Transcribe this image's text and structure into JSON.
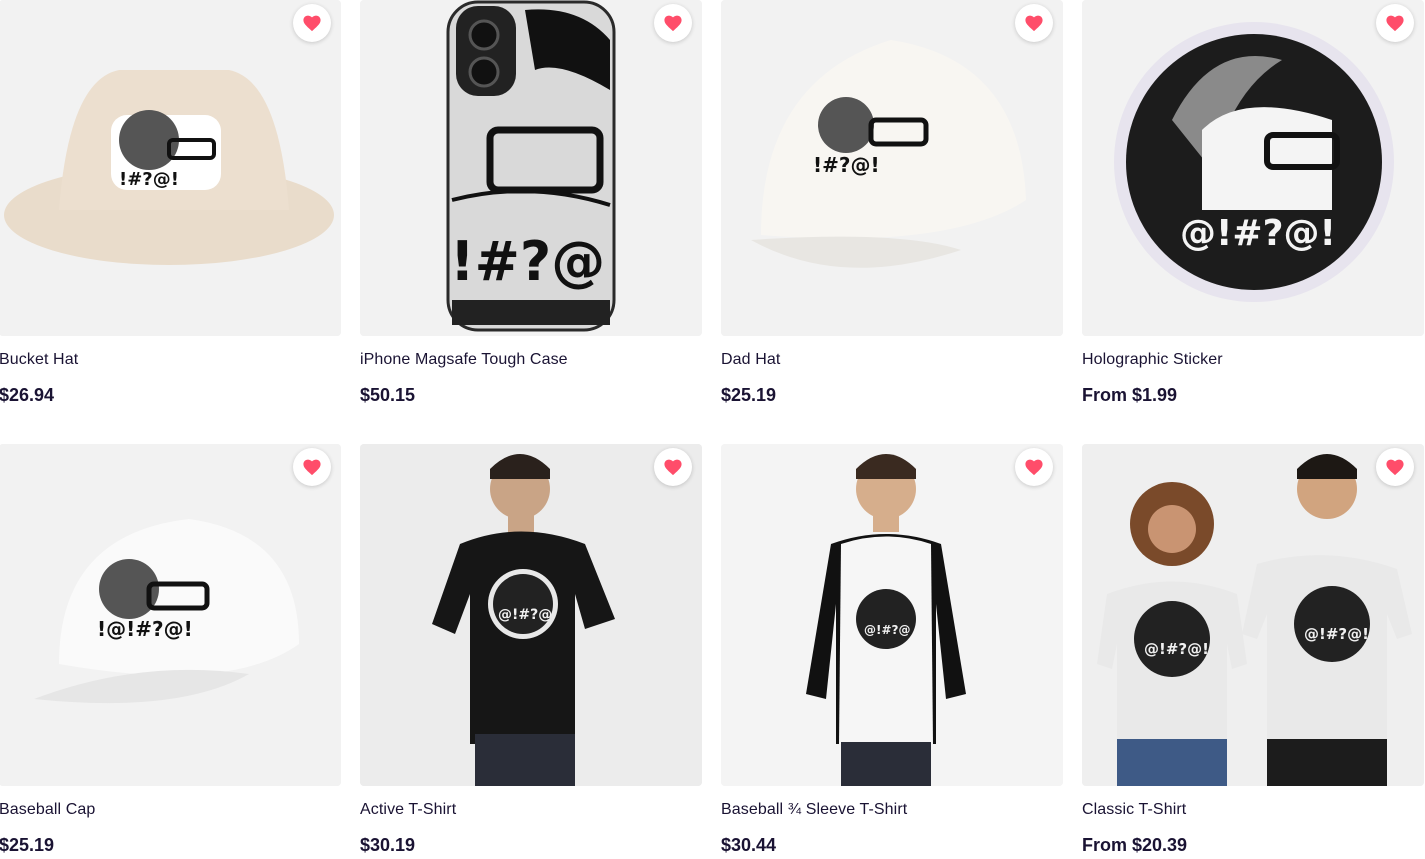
{
  "colors": {
    "heart": "#ff4d6a",
    "text": "#1a1333",
    "card_bg": "#f2f2f2"
  },
  "products": [
    {
      "title": "Bucket Hat",
      "price": "$26.94",
      "favorite_icon": "heart-icon"
    },
    {
      "title": "iPhone Magsafe Tough Case",
      "price": "$50.15",
      "favorite_icon": "heart-icon"
    },
    {
      "title": "Dad Hat",
      "price": "$25.19",
      "favorite_icon": "heart-icon"
    },
    {
      "title": "Holographic Sticker",
      "price": "From $1.99",
      "favorite_icon": "heart-icon"
    },
    {
      "title": "Baseball Cap",
      "price": "$25.19",
      "favorite_icon": "heart-icon"
    },
    {
      "title": "Active T-Shirt",
      "price": "$30.19",
      "favorite_icon": "heart-icon"
    },
    {
      "title": "Baseball ¾ Sleeve T-Shirt",
      "price": "$30.44",
      "favorite_icon": "heart-icon"
    },
    {
      "title": "Classic T-Shirt",
      "price": "From $20.39",
      "favorite_icon": "heart-icon"
    }
  ]
}
